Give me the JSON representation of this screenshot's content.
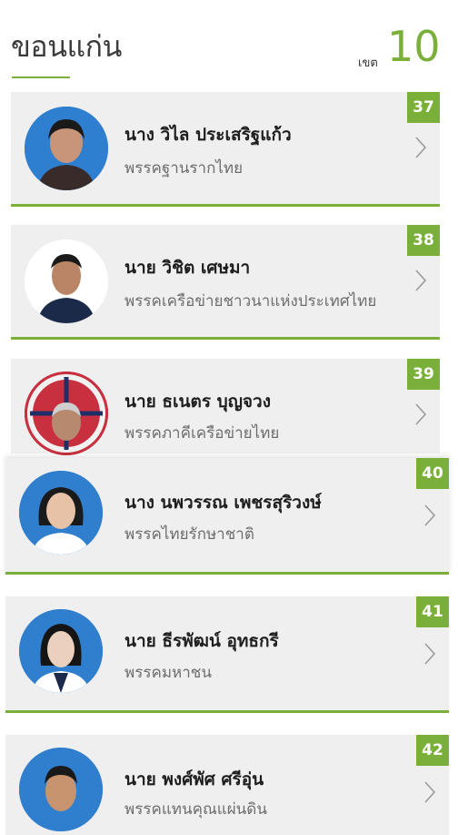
{
  "header": {
    "province": "ขอนแก่น",
    "district_label": "เขต",
    "district_number": "10"
  },
  "colors": {
    "accent": "#7ab03a",
    "card_bg": "#efefef"
  },
  "candidates": [
    {
      "number": "37",
      "name": "นาง วิไล ประเสริฐแก้ว",
      "party": "พรรคฐานรากไทย",
      "avatar_icon": "candidate-photo"
    },
    {
      "number": "38",
      "name": "นาย วิชิต เศษมา",
      "party": "พรรคเครือข่ายชาวนาแห่งประเทศไทย",
      "avatar_icon": "candidate-photo"
    },
    {
      "number": "39",
      "name": "นาย ธเนตร บุญจวง",
      "party": "พรรคภาคีเครือข่ายไทย",
      "avatar_icon": "candidate-photo"
    },
    {
      "number": "40",
      "name": "นาง นพวรรณ เพชรสุริวงษ์",
      "party": "พรรคไทยรักษาชาติ",
      "avatar_icon": "candidate-photo"
    },
    {
      "number": "41",
      "name": "นาย ธีรพัฒน์ อุทธกรี",
      "party": "พรรคมหาชน",
      "avatar_icon": "candidate-photo"
    },
    {
      "number": "42",
      "name": "นาย พงศ์พัศ ศรีอุ่น",
      "party": "พรรคแทนคุณแผ่นดิน",
      "avatar_icon": "candidate-photo"
    }
  ]
}
